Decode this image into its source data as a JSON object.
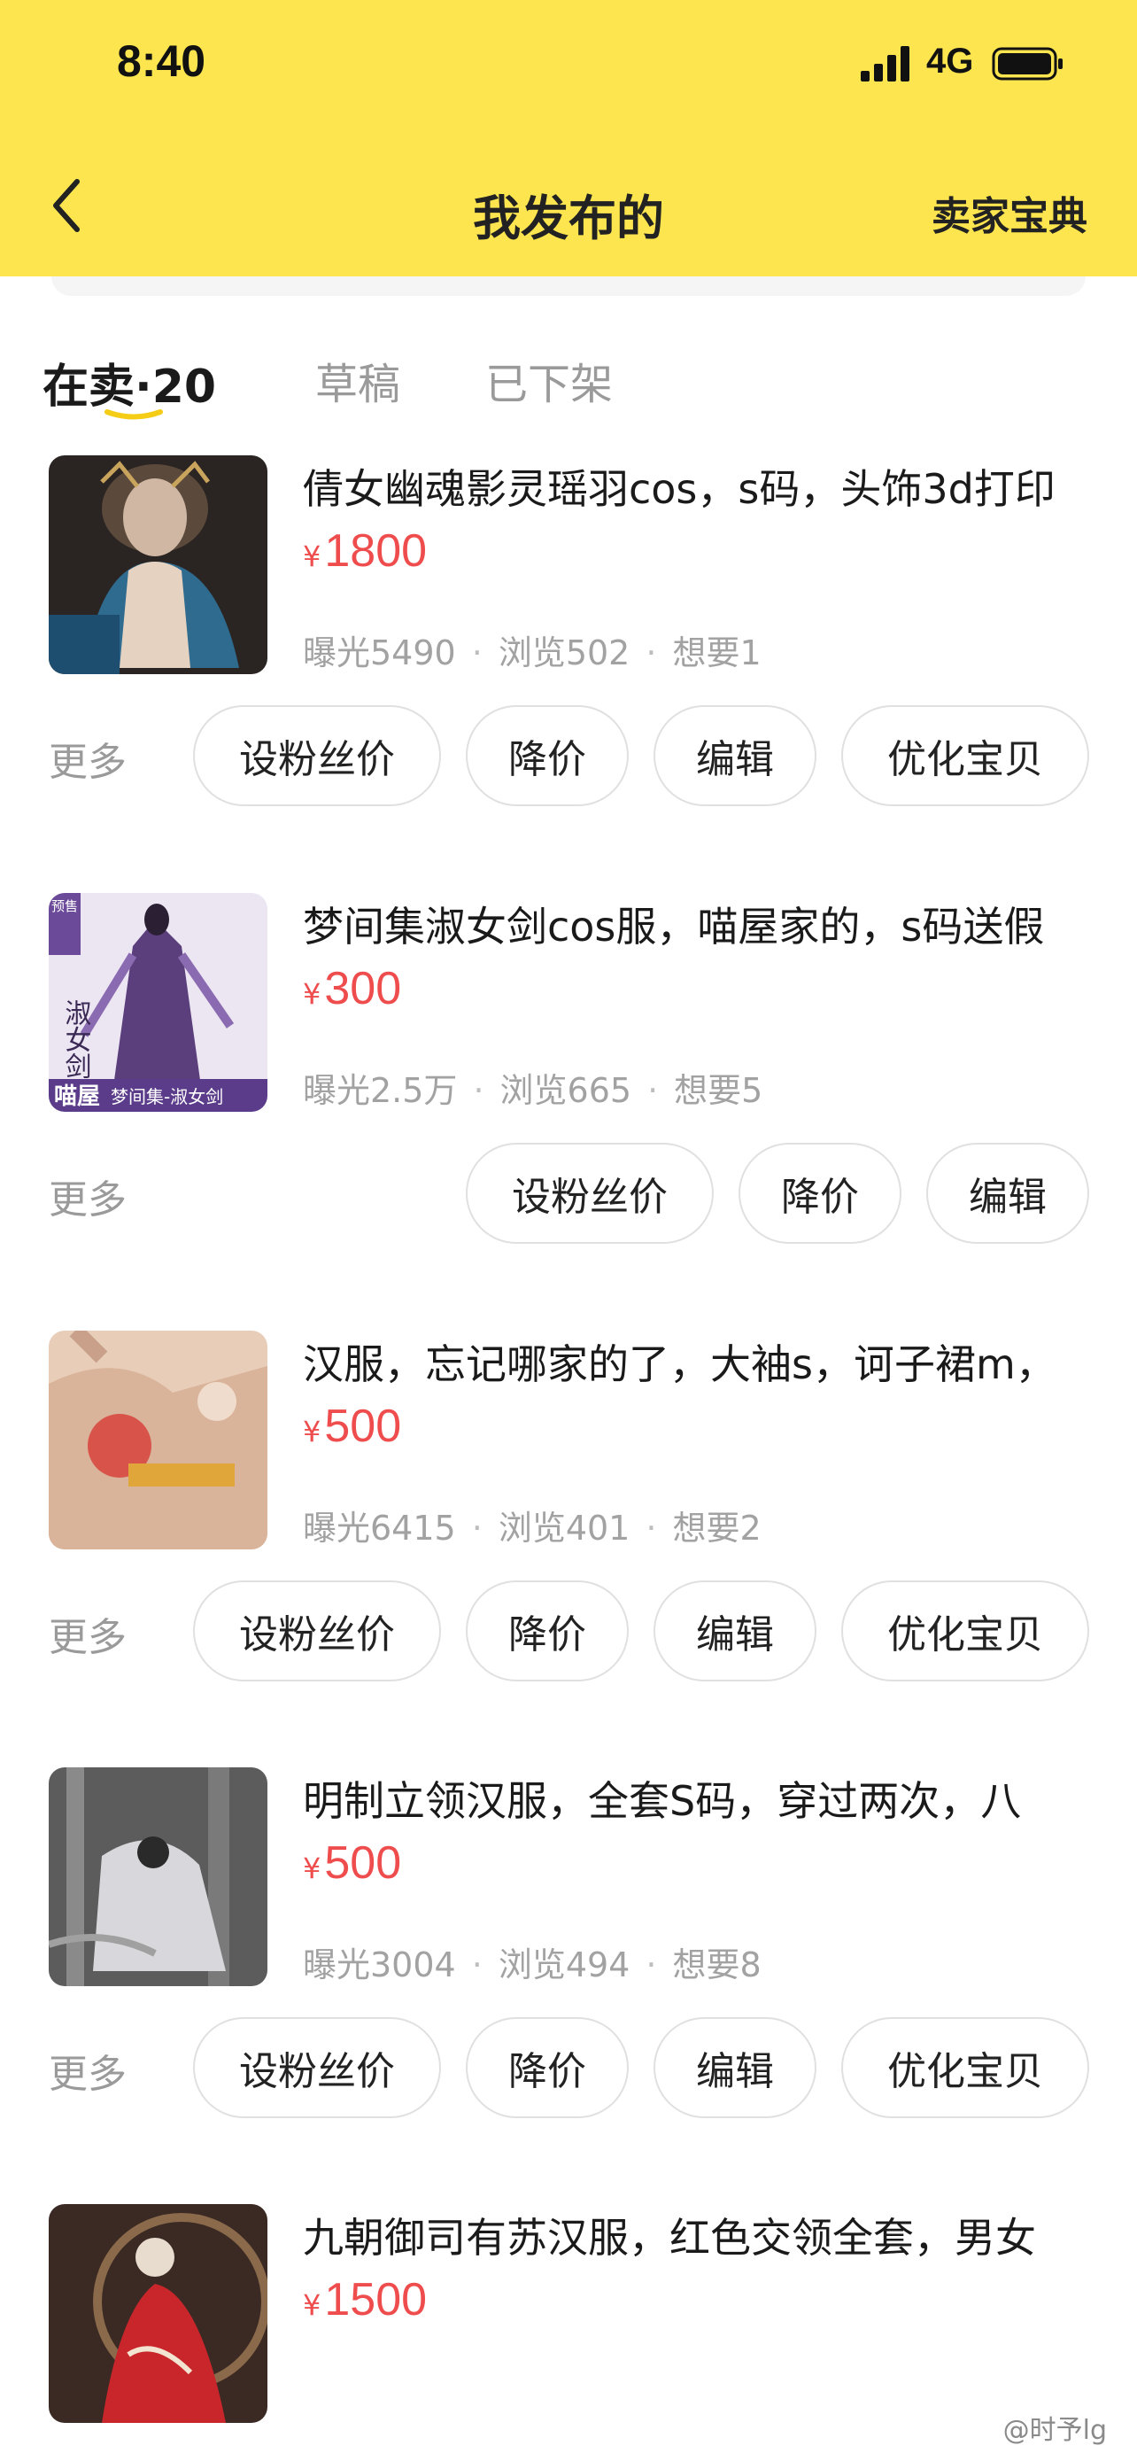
{
  "status_bar": {
    "time": "8:40",
    "network": "4G"
  },
  "nav": {
    "title": "我发布的",
    "seller_guide": "卖家宝典"
  },
  "tabs": [
    {
      "label": "在卖·20",
      "active": true
    },
    {
      "label": "草稿",
      "active": false
    },
    {
      "label": "已下架",
      "active": false
    }
  ],
  "accent_color": "#fce54f",
  "price_color": "#ef4d4d",
  "more_label": "更多",
  "items": [
    {
      "title": "倩女幽魂影灵瑶羽cos，s码，头饰3d打印",
      "currency": "¥",
      "price": "1800",
      "exposure": "曝光5490",
      "views": "浏览502",
      "wants": "想要1",
      "actions": [
        "设粉丝价",
        "降价",
        "编辑",
        "优化宝贝"
      ]
    },
    {
      "title": "梦间集淑女剑cos服，喵屋家的，s码送假",
      "currency": "¥",
      "price": "300",
      "exposure": "曝光2.5万",
      "views": "浏览665",
      "wants": "想要5",
      "actions": [
        "设粉丝价",
        "降价",
        "编辑"
      ],
      "thumb_text": {
        "badge": "预售",
        "calligraphy": "淑女剑",
        "store": "喵屋",
        "caption": "梦间集-淑女剑"
      }
    },
    {
      "title": "汉服，忘记哪家的了，大袖s，诃子裙m，",
      "currency": "¥",
      "price": "500",
      "exposure": "曝光6415",
      "views": "浏览401",
      "wants": "想要2",
      "actions": [
        "设粉丝价",
        "降价",
        "编辑",
        "优化宝贝"
      ]
    },
    {
      "title": "明制立领汉服，全套S码，穿过两次，八",
      "currency": "¥",
      "price": "500",
      "exposure": "曝光3004",
      "views": "浏览494",
      "wants": "想要8",
      "actions": [
        "设粉丝价",
        "降价",
        "编辑",
        "优化宝贝"
      ]
    },
    {
      "title": "九朝御司有苏汉服，红色交领全套，男女",
      "currency": "¥",
      "price": "1500",
      "exposure": "",
      "views": "",
      "wants": "",
      "actions": []
    }
  ],
  "watermark": "@时予lg"
}
